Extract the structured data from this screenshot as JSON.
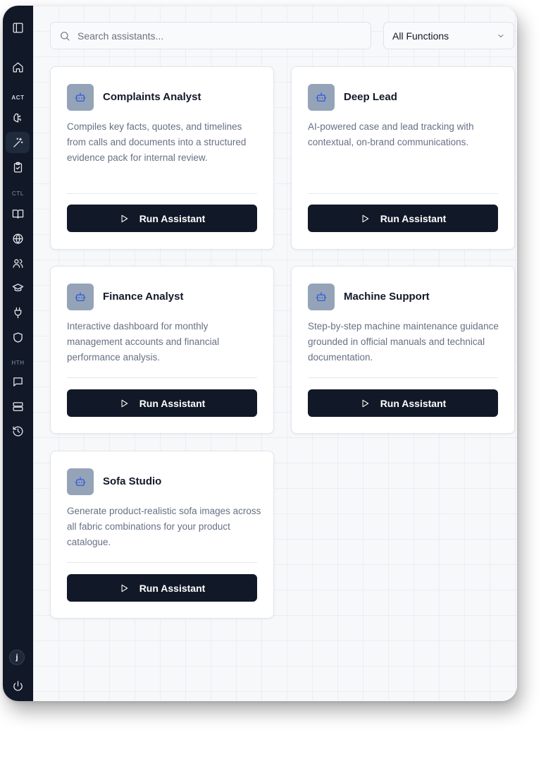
{
  "sidebar": {
    "sections": [
      "ACT",
      "CTL",
      "HTH"
    ],
    "avatar_initial": "j",
    "icons": [
      "panel-toggle-icon",
      "home-icon",
      "brain-icon",
      "magic-wand-icon",
      "clipboard-icon",
      "book-icon",
      "globe-icon",
      "users-icon",
      "graduation-cap-icon",
      "plug-icon",
      "shield-icon",
      "chat-icon",
      "server-icon",
      "history-icon",
      "power-icon"
    ]
  },
  "search": {
    "placeholder": "Search assistants..."
  },
  "filter": {
    "selected": "All Functions"
  },
  "assistants": [
    {
      "title": "Complaints Analyst",
      "description": "Compiles key facts, quotes, and timelines from calls and documents into a structured evidence pack for internal review.",
      "button": "Run Assistant"
    },
    {
      "title": "Deep Lead",
      "description": "AI-powered case and lead tracking with contextual, on-brand communications.",
      "button": "Run Assistant"
    },
    {
      "title": "Finance Analyst",
      "description": "Interactive dashboard for monthly management accounts and financial performance analysis.",
      "button": "Run Assistant"
    },
    {
      "title": "Machine Support",
      "description": "Step-by-step machine maintenance guidance grounded in official manuals and technical documentation.",
      "button": "Run Assistant"
    },
    {
      "title": "Sofa Studio",
      "description": "Generate product-realistic sofa images across all fabric combinations for your product catalogue.",
      "button": "Run Assistant"
    }
  ],
  "colors": {
    "sidebar": "#111827",
    "button": "#111827",
    "icon_tile": "#94a3b8",
    "icon_accent": "#2f5cd8"
  }
}
